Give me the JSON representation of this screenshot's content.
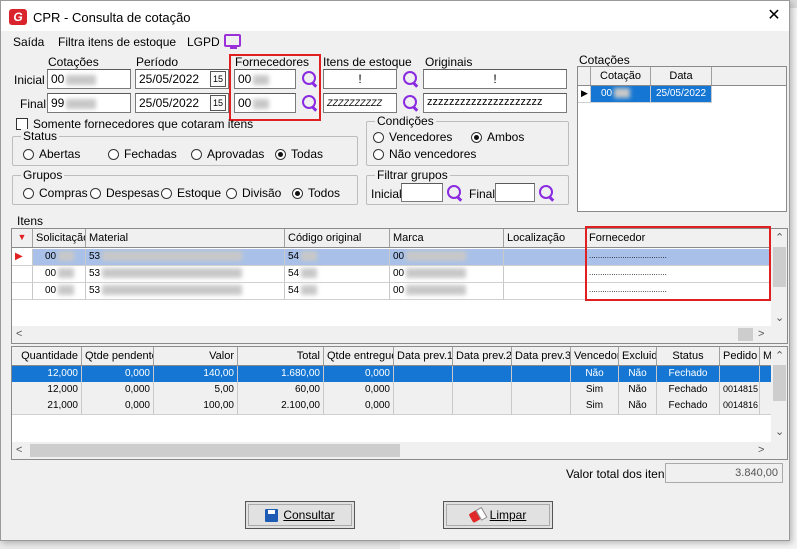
{
  "window": {
    "title": "CPR - Consulta de cotação",
    "close_label": "✕"
  },
  "menu": {
    "items": [
      "Saída",
      "Filtra itens de estoque",
      "LGPD"
    ]
  },
  "filters": {
    "col_cotacoes": "Cotações",
    "col_periodo": "Período",
    "col_fornecedores": "Fornecedores",
    "col_itens_estoque": "Itens de estoque",
    "col_originais": "Originais",
    "row_inicial": "Inicial",
    "row_final": "Final",
    "cot_inicial": "00",
    "cot_final": "99",
    "periodo_inicial": "25/05/2022",
    "periodo_final": "25/05/2022",
    "calendar_glyph": "15",
    "forn_inicial": "00",
    "forn_final": "00",
    "item_inicial": "!",
    "item_final": "ZZZZZZZZZZ",
    "orig_inicial": "!",
    "orig_final": "zzzzzzzzzzzzzzzzzzzzz"
  },
  "check_fornecedores": "Somente fornecedores que cotaram itens",
  "status": {
    "title": "Status",
    "options": [
      "Abertas",
      "Fechadas",
      "Aprovadas",
      "Todas"
    ],
    "selected": "Todas"
  },
  "condicoes": {
    "title": "Condições",
    "options": [
      "Vencedores",
      "Ambos",
      "Não vencedores"
    ],
    "selected": "Ambos"
  },
  "grupos": {
    "title": "Grupos",
    "options": [
      "Compras",
      "Despesas",
      "Estoque",
      "Divisão",
      "Todos"
    ],
    "selected": "Todos"
  },
  "filtrar_grupos": {
    "title": "Filtrar grupos",
    "inicial": "Inicial",
    "final": "Final"
  },
  "cotacoes_panel": {
    "title": "Cotações",
    "headers": [
      "Cotação",
      "Data"
    ],
    "rows": [
      {
        "cotacao": "00",
        "data": "25/05/2022"
      }
    ]
  },
  "itens": {
    "title": "Itens",
    "headers": [
      "Solicitação",
      "Material",
      "Código original",
      "Marca",
      "Localização",
      "Fornecedor"
    ],
    "rows": [
      {
        "solicitacao": "00",
        "material": "53",
        "codigo": "54",
        "marca": "00",
        "localizacao": "",
        "fornecedor": "..................................."
      },
      {
        "solicitacao": "00",
        "material": "53",
        "codigo": "54",
        "marca": "00",
        "localizacao": "",
        "fornecedor": "..................................."
      },
      {
        "solicitacao": "00",
        "material": "53",
        "codigo": "54",
        "marca": "00",
        "localizacao": "",
        "fornecedor": "..................................."
      }
    ]
  },
  "detalhes": {
    "headers": [
      "Quantidade",
      "Qtde pendente",
      "Valor",
      "Total",
      "Qtde entregue",
      "Data prev.1",
      "Data prev.2",
      "Data prev.3",
      "Vencedor",
      "Excluido",
      "Status",
      "Pedido",
      "M"
    ],
    "rows": [
      {
        "quantidade": "12,000",
        "pendente": "0,000",
        "valor": "140,00",
        "total": "1.680,00",
        "entregue": "0,000",
        "d1": "",
        "d2": "",
        "d3": "",
        "vencedor": "Não",
        "excluido": "Não",
        "status": "Fechado",
        "pedido": ""
      },
      {
        "quantidade": "12,000",
        "pendente": "0,000",
        "valor": "5,00",
        "total": "60,00",
        "entregue": "0,000",
        "d1": "",
        "d2": "",
        "d3": "",
        "vencedor": "Sim",
        "excluido": "Não",
        "status": "Fechado",
        "pedido": "0014815"
      },
      {
        "quantidade": "21,000",
        "pendente": "0,000",
        "valor": "100,00",
        "total": "2.100,00",
        "entregue": "0,000",
        "d1": "",
        "d2": "",
        "d3": "",
        "vencedor": "Sim",
        "excluido": "Não",
        "status": "Fechado",
        "pedido": "0014816"
      }
    ]
  },
  "footer": {
    "valor_total_label": "Valor total dos itens",
    "valor_total": "3.840,00",
    "consultar_label": "Consultar",
    "limpar_label": "Limpar"
  },
  "colors": {
    "accent_purple": "#8a2be2",
    "highlight_red": "#e02020",
    "selected_blue": "#1577d3",
    "row_selected": "#a9c1e8"
  }
}
